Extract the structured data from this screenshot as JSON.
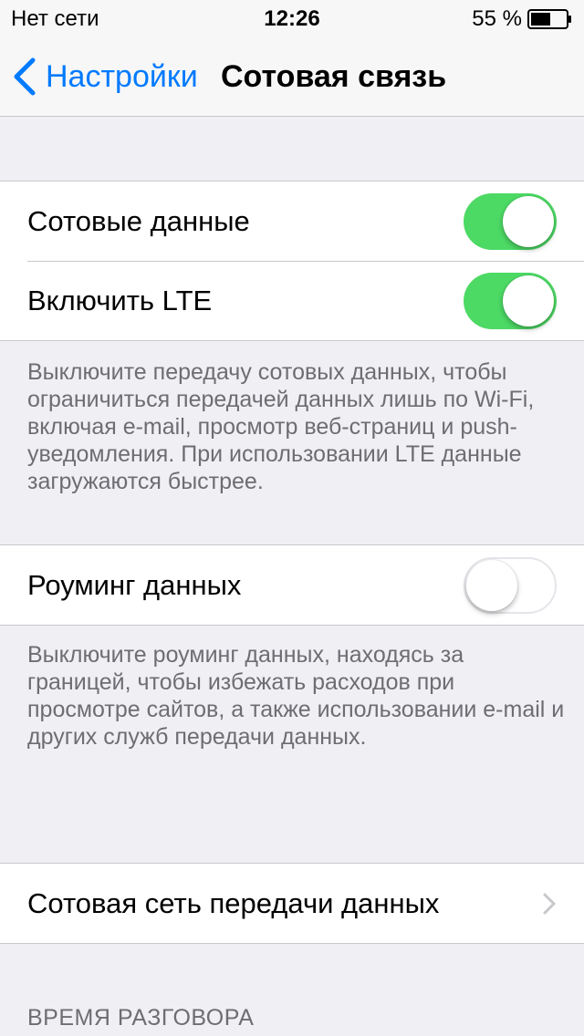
{
  "status_bar": {
    "carrier": "Нет сети",
    "time": "12:26",
    "battery_percent": "55 %"
  },
  "nav": {
    "back_label": "Настройки",
    "title": "Сотовая связь"
  },
  "group1": {
    "rows": [
      {
        "label": "Сотовые данные",
        "toggle": "on"
      },
      {
        "label": "Включить LTE",
        "toggle": "on"
      }
    ],
    "footer": "Выключите передачу сотовых данных, чтобы ограничиться передачей данных лишь по Wi-Fi, включая e-mail, просмотр веб-страниц и push-уведомления. При использовании LTE данные загружаются быстрее."
  },
  "group2": {
    "rows": [
      {
        "label": "Роуминг данных",
        "toggle": "off"
      }
    ],
    "footer": "Выключите роуминг данных, находясь за границей, чтобы избежать расходов при просмотре сайтов, а также использовании e-mail и других служб передачи данных."
  },
  "group3": {
    "rows": [
      {
        "label": "Сотовая сеть передачи данных",
        "accessory": "chevron-right-icon"
      }
    ]
  },
  "section_header": "ВРЕМЯ РАЗГОВОРА",
  "colors": {
    "accent": "#007aff",
    "toggle_on": "#4cd964",
    "background": "#efeff4",
    "footer_text": "#6d6d72"
  }
}
